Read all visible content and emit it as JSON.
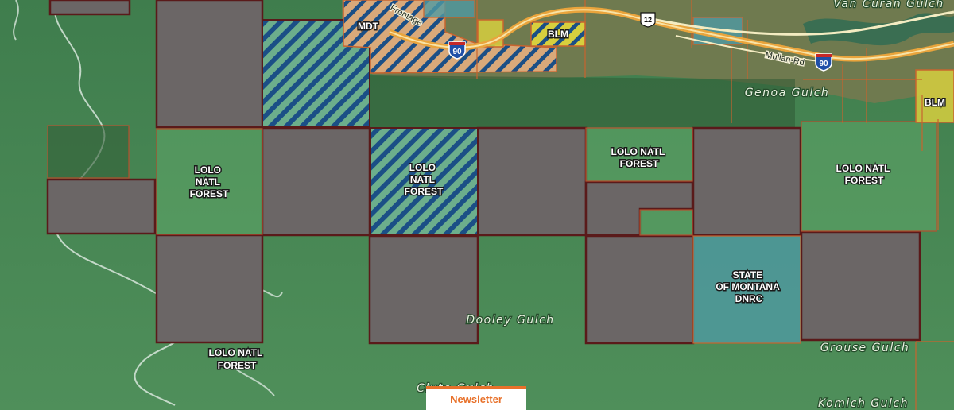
{
  "map": {
    "parcel_labels": {
      "mdt": "MDT",
      "blm_top": "BLM",
      "blm_right": "BLM",
      "lolo_left": [
        "LOLO",
        "NATL",
        "FOREST"
      ],
      "lolo_center": [
        "LOLO",
        "NATL",
        "FOREST"
      ],
      "lolo_right_center": [
        "LOLO NATL",
        "FOREST"
      ],
      "lolo_right": [
        "LOLO NATL",
        "FOREST"
      ],
      "lolo_bottom": [
        "LOLO NATL",
        "FOREST"
      ],
      "state": [
        "STATE",
        "OF MONTANA",
        "DNRC"
      ]
    },
    "place_names": {
      "van_curan": "Van Curan Gulch",
      "genoa": "Genoa Gulch",
      "dooley": "Dooley Gulch",
      "grouse": "Grouse Gulch",
      "komich": "Komich Gulch",
      "clute": "Clute Gulch"
    },
    "roads": {
      "frontage": "Frontage",
      "mullan": "Mullan-Rd"
    },
    "shields": {
      "interstate_1": "90",
      "interstate_2": "90",
      "us_highway": "12"
    },
    "colors": {
      "private": "#6b6666",
      "boundary": "#5a1a1a",
      "hatch_blue": "#1b4f86",
      "hatch_tan": "#d9a97a",
      "state": "#4f9aa3",
      "blm_yellow": "#d7cf3e",
      "forest": "#5ea568",
      "newsletter_accent": "#e8712a"
    }
  },
  "newsletter": {
    "label": "Newsletter"
  }
}
